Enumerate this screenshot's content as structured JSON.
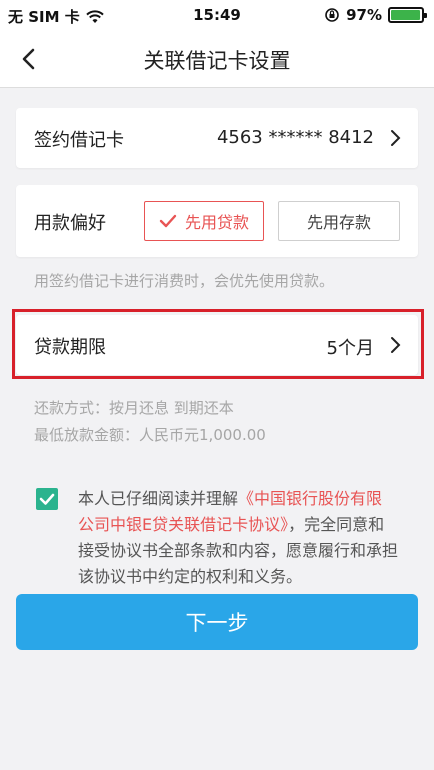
{
  "status_bar": {
    "carrier": "无 SIM 卡",
    "time": "15:49",
    "battery": "97%",
    "battery_level": 0.97
  },
  "nav": {
    "title": "关联借记卡设置"
  },
  "debit_card": {
    "label": "签约借记卡",
    "value": "4563 ****** 8412"
  },
  "preference": {
    "label": "用款偏好",
    "option_loan": "先用贷款",
    "option_deposit": "先用存款",
    "selected": "先用贷款",
    "hint": "用签约借记卡进行消费时，会优先使用贷款。"
  },
  "term": {
    "label": "贷款期限",
    "value": "5个月"
  },
  "info": {
    "repayment": "还款方式：按月还息 到期还本",
    "min_amount": "最低放款金额：人民币元1,000.00"
  },
  "agreement": {
    "checked": true,
    "text_before": "本人已仔细阅读并理解",
    "link": "《中国银行股份有限公司中银E贷关联借记卡协议》",
    "text_after": "，完全同意和接受协议书全部条款和内容，愿意履行和承担该协议书中约定的权利和义务。"
  },
  "next_button": {
    "label": "下一步"
  },
  "colors": {
    "accent_red": "#e85454",
    "highlight_red": "#d8202a",
    "check_green": "#2bb38e",
    "button_blue": "#2aa6e8"
  }
}
